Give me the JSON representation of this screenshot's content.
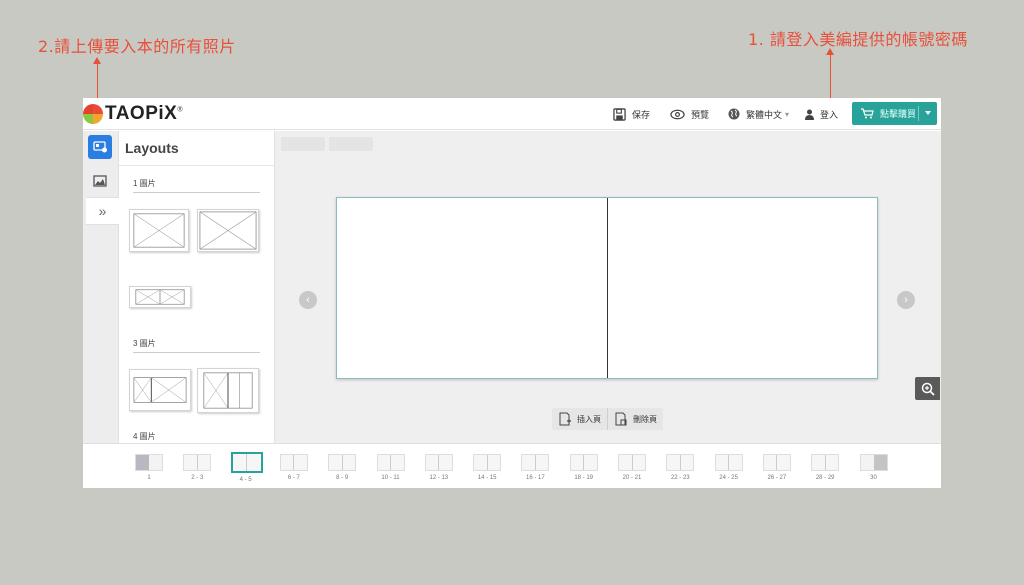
{
  "annotations": {
    "left": "2.請上傳要入本的所有照片",
    "right": "1. 請登入美編提供的帳號密碼"
  },
  "brand": {
    "name": "TAOPiX",
    "trademark": "®"
  },
  "toolbar": {
    "save": "保存",
    "preview": "預覽",
    "language": "繁體中文",
    "login": "登入",
    "buy": "點擊購買"
  },
  "panel": {
    "title": "Layouts",
    "sections": [
      {
        "label": "1 圖片"
      },
      {
        "label": "3 圖片"
      },
      {
        "label": "4 圖片"
      }
    ]
  },
  "page_actions": {
    "insert": "插入頁",
    "delete": "刪除頁"
  },
  "filmstrip": {
    "selected": "4 - 5",
    "pages": [
      "1",
      "2 - 3",
      "4 - 5",
      "6 - 7",
      "8 - 9",
      "10 - 11",
      "12 - 13",
      "14 - 15",
      "16 - 17",
      "18 - 19",
      "20 - 21",
      "22 - 23",
      "24 - 25",
      "26 - 27",
      "28 - 29",
      "30"
    ]
  },
  "colors": {
    "annotation": "#e8503a",
    "accent": "#27a39a",
    "rail_active": "#2a7de1"
  }
}
